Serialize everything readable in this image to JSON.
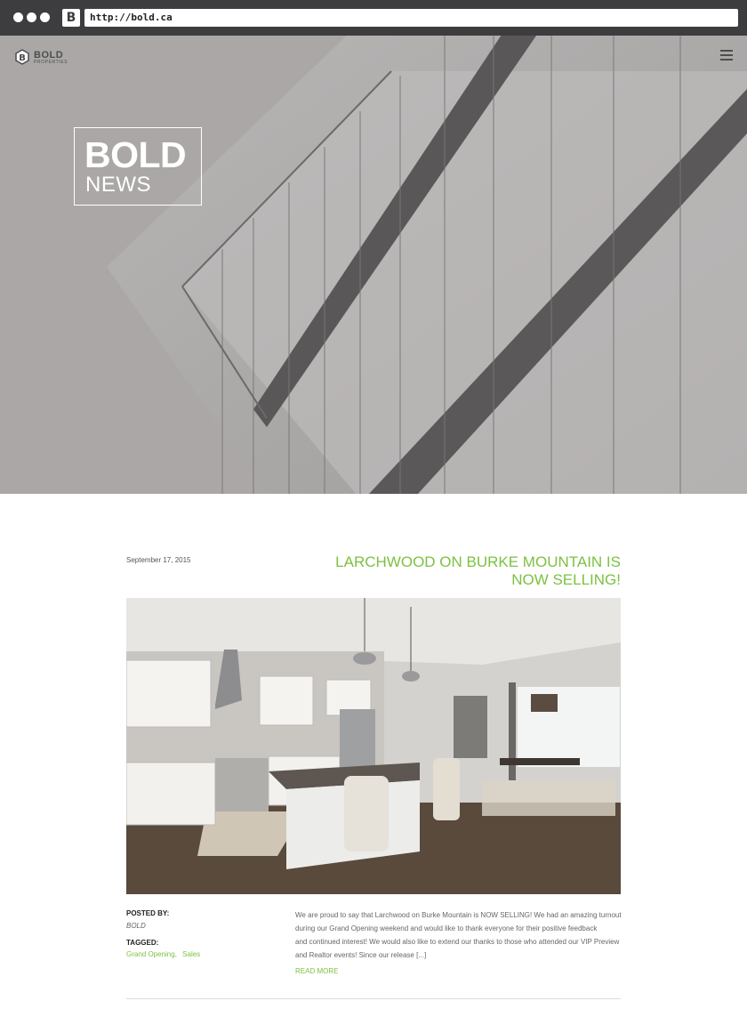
{
  "browser": {
    "favicon_letter": "B",
    "url": "http://bold.ca"
  },
  "header": {
    "logo_text": "BOLD",
    "logo_subtext": "PROPERTIES",
    "menu_icon": "hamburger-menu-icon"
  },
  "hero": {
    "title_bold": "BOLD",
    "title_light": "NEWS"
  },
  "post": {
    "date": "September 17, 2015",
    "title_line1": "LARCHWOOD ON BURKE MOUNTAIN IS",
    "title_line2": "NOW SELLING!",
    "posted_by_label": "POSTED BY:",
    "author": "BOLD",
    "tagged_label": "TAGGED:",
    "tags": [
      "Grand Opening,",
      "Sales"
    ],
    "excerpt_lines": [
      "We are proud to say that Larchwood on Burke Mountain is NOW SELLING! We had an amazing turnout",
      "during our Grand Opening weekend and would like to thank everyone for their positive feedback",
      "and continued interest! We would also like to extend our thanks to those who attended our VIP Preview",
      "and Realtor events! Since our release [...]"
    ],
    "read_more": "READ MORE"
  },
  "colors": {
    "accent": "#7cc142",
    "chrome": "#3d3d3f",
    "hero_bg": "#a9a6a5"
  }
}
